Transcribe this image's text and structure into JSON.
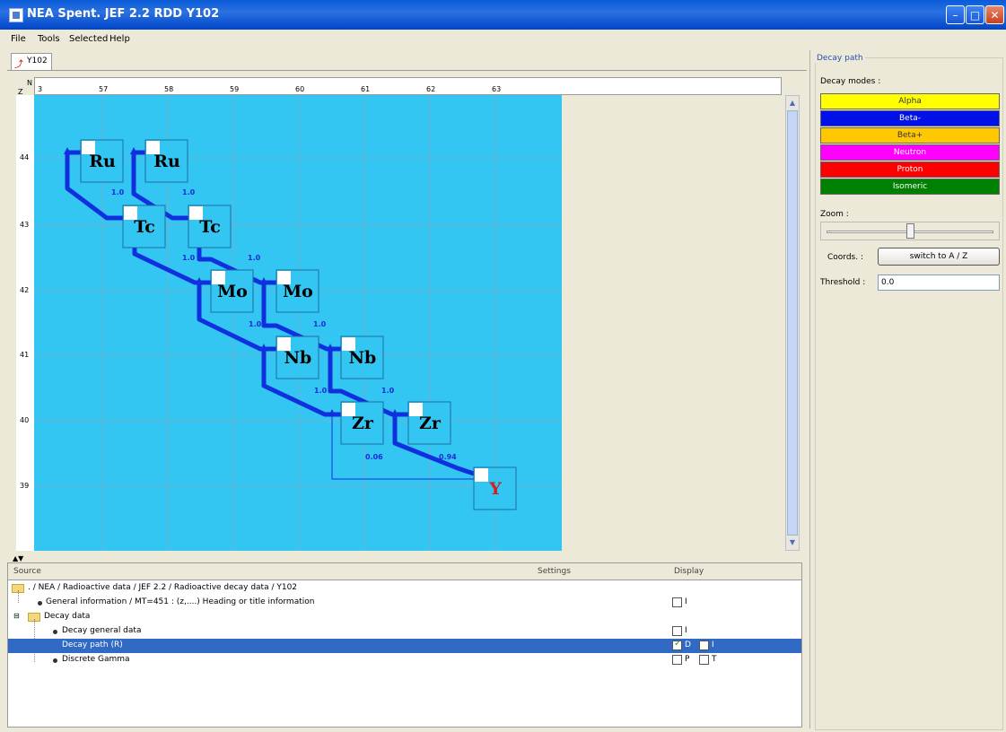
{
  "window": {
    "title": "NEA Spent. JEF 2.2 RDD Y102"
  },
  "menu": {
    "items": [
      "File",
      "Tools",
      "Selected",
      "Help"
    ]
  },
  "tab": {
    "label": "Y102",
    "icon": "decay-graph-icon"
  },
  "axes": {
    "corner_n": "N",
    "corner_z": "Z",
    "n_ticks": [
      "3",
      "57",
      "58",
      "59",
      "60",
      "61",
      "62",
      "63"
    ],
    "z_ticks": [
      "44",
      "43",
      "42",
      "41",
      "40",
      "39"
    ]
  },
  "nuclides": [
    {
      "symbol": "Ru",
      "color": "#000000"
    },
    {
      "symbol": "Ru",
      "color": "#000000"
    },
    {
      "symbol": "Tc",
      "color": "#000000"
    },
    {
      "symbol": "Tc",
      "color": "#000000"
    },
    {
      "symbol": "Mo",
      "color": "#000000"
    },
    {
      "symbol": "Mo",
      "color": "#000000"
    },
    {
      "symbol": "Nb",
      "color": "#000000"
    },
    {
      "symbol": "Nb",
      "color": "#000000"
    },
    {
      "symbol": "Zr",
      "color": "#000000"
    },
    {
      "symbol": "Zr",
      "color": "#000000"
    },
    {
      "symbol": "Y",
      "color": "#cc2222"
    }
  ],
  "branch_labels": [
    "1.0",
    "1.0",
    "1.0",
    "1.0",
    "1.0",
    "1.0",
    "1.0",
    "1.0",
    "0.06",
    "0.94"
  ],
  "colors": {
    "chart_bg": "#34C6F2",
    "path": "#1030E0",
    "selection": "#316AC5"
  },
  "tree": {
    "headers": {
      "source": "Source",
      "settings": "Settings",
      "display": "Display"
    },
    "rows": [
      {
        "text": ". / NEA / Radioactive data / JEF 2.2 / Radioactive decay data / Y102"
      },
      {
        "text": "General information / MT=451 : (z,....) Heading or title information",
        "cb1": "I"
      },
      {
        "text": "Decay data"
      },
      {
        "text": "Decay general data",
        "cb1": "I"
      },
      {
        "text": "Decay path (R)",
        "cb1": "D",
        "cb2": "I"
      },
      {
        "text": "Discrete Gamma",
        "cb1": "P",
        "cb2": "T"
      }
    ]
  },
  "panel": {
    "title": "Decay path",
    "decay_modes_label": "Decay modes :",
    "modes": [
      {
        "label": "Alpha",
        "bg": "#FFFF00",
        "fg": "#333333"
      },
      {
        "label": "Beta-",
        "bg": "#0010E8",
        "fg": "#ffffff"
      },
      {
        "label": "Beta+",
        "bg": "#FFC800",
        "fg": "#333333"
      },
      {
        "label": "Neutron",
        "bg": "#FF00FF",
        "fg": "#ffffff"
      },
      {
        "label": "Proton",
        "bg": "#FF0000",
        "fg": "#ffffff"
      },
      {
        "label": "Isomeric",
        "bg": "#008000",
        "fg": "#ffffff"
      }
    ],
    "zoom_label": "Zoom :",
    "zoom_value": 0.5,
    "coords_label": "Coords. :",
    "switch_button": "switch to A / Z",
    "threshold_label": "Threshold :",
    "threshold_value": "0.0"
  }
}
